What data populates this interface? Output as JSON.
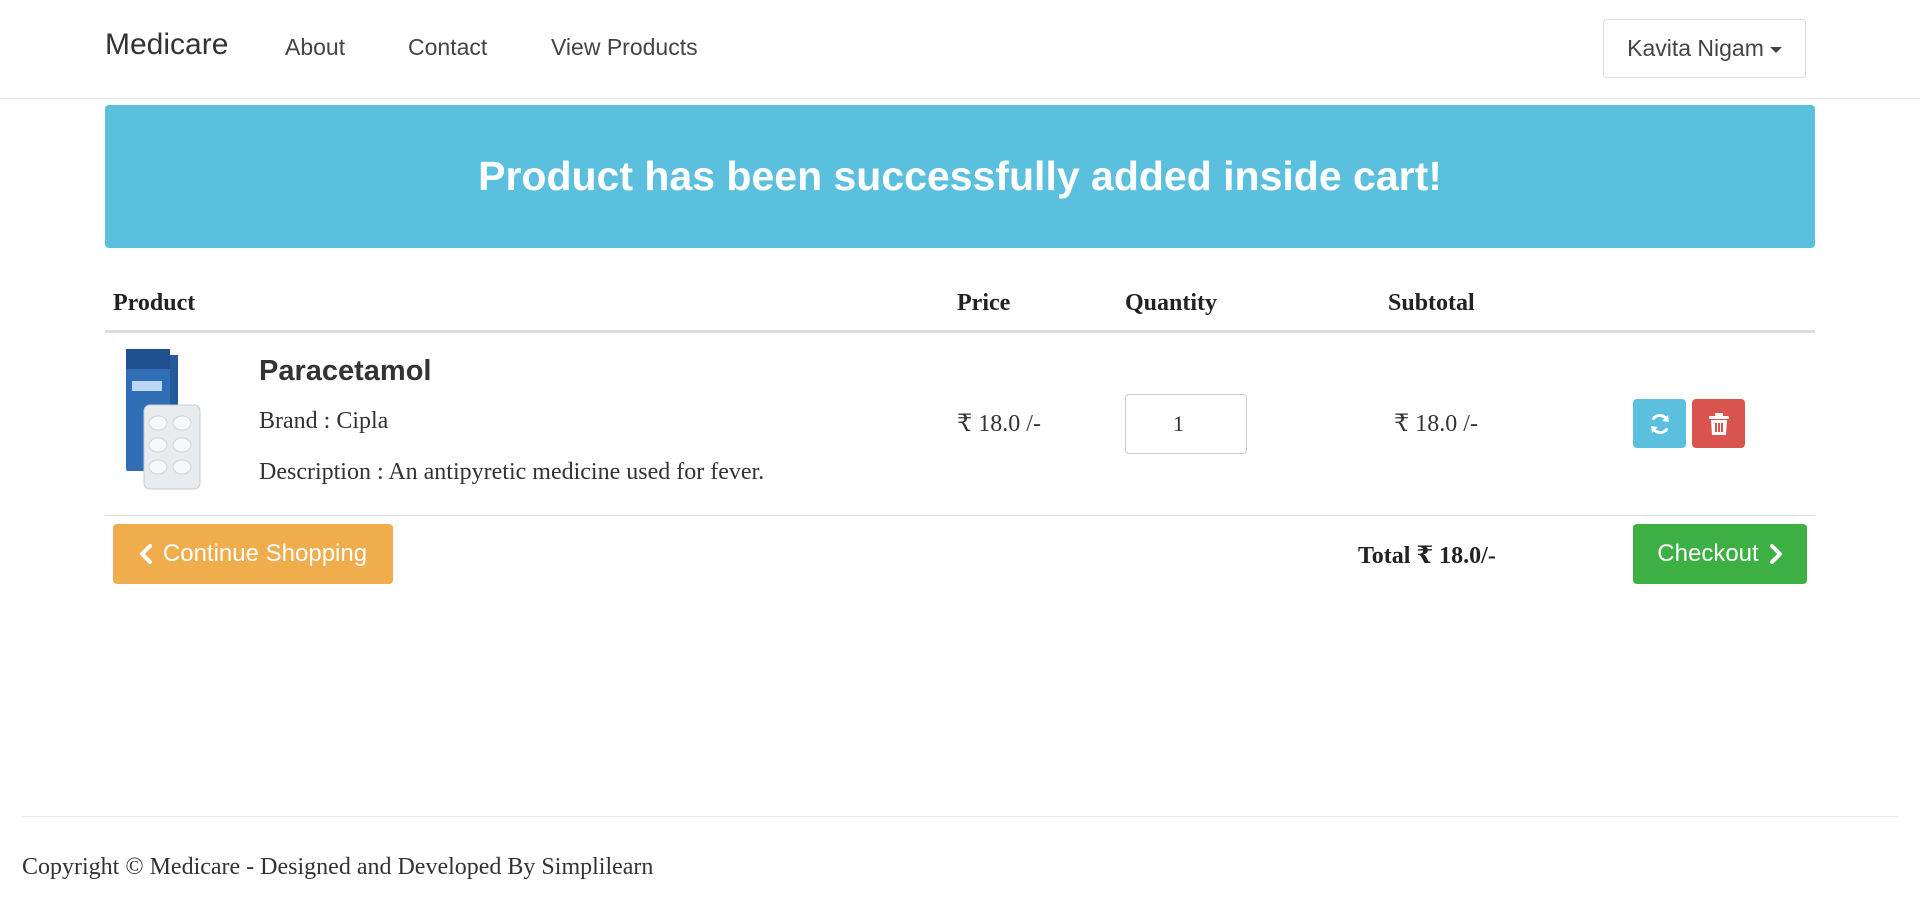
{
  "navbar": {
    "brand": "Medicare",
    "links": [
      "About",
      "Contact",
      "View Products"
    ],
    "user_name": "Kavita Nigam"
  },
  "alert": {
    "message": "Product has been successfully added inside cart!",
    "color": "#5bc0de"
  },
  "cart": {
    "headers": {
      "product": "Product",
      "price": "Price",
      "quantity": "Quantity",
      "subtotal": "Subtotal"
    },
    "items": [
      {
        "name": "Paracetamol",
        "brand": "Brand : Cipla",
        "description": "Description : An antipyretic medicine used for fever.",
        "price": "₹ 18.0 /-",
        "quantity": "1",
        "subtotal": "₹ 18.0 /-"
      }
    ],
    "total": "Total ₹ 18.0/-",
    "continue_label": "Continue Shopping",
    "checkout_label": "Checkout"
  },
  "footer": {
    "copyright": "Copyright © Medicare - Designed and Developed By Simplilearn"
  },
  "icons": {
    "refresh": "refresh-icon",
    "delete": "trash-icon",
    "chevron_left": "chevron-left-icon",
    "chevron_right": "chevron-right-icon",
    "caret": "caret-down-icon"
  },
  "colors": {
    "info": "#5bc0de",
    "danger": "#d9534f",
    "warning": "#f0ad4e",
    "success": "#3cb043"
  }
}
